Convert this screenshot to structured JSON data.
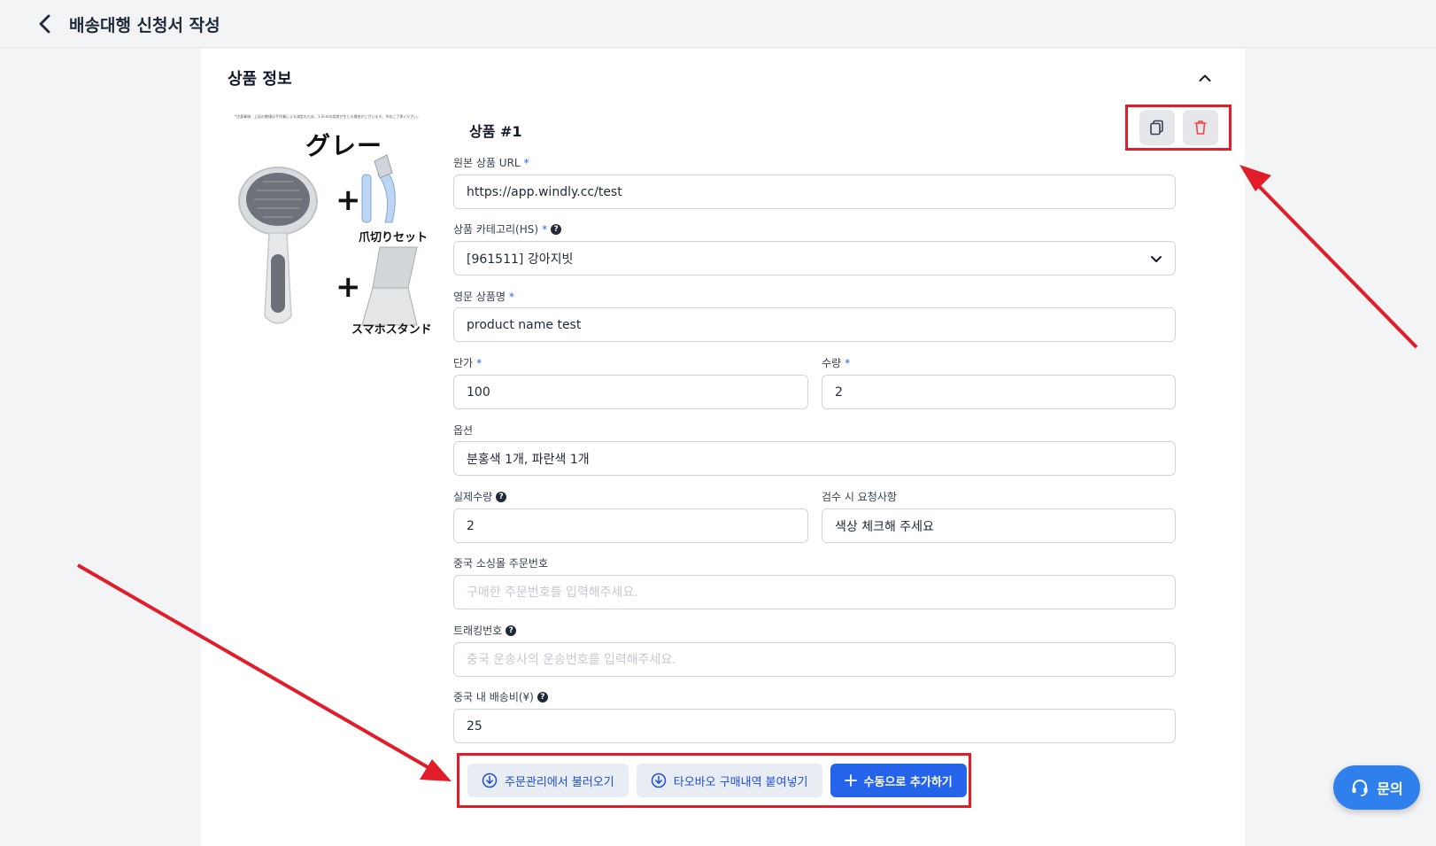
{
  "header": {
    "title": "배송대행 신청서 작성"
  },
  "section": {
    "title": "상품 정보"
  },
  "product_image": {
    "caption_top": "*注意事項：上記の数値は手作業による測定のため、1-2cmの誤差が生じる場合がございます。予めご了承ください。",
    "color_title": "グレー",
    "label_1": "爪切りセット",
    "label_2": "スマホスタンド"
  },
  "product": {
    "heading": "상품 #1",
    "url": {
      "label": "원본 상품 URL",
      "required": "*",
      "value": "https://app.windly.cc/test"
    },
    "category": {
      "label": "상품 카테고리(HS)",
      "required": "*",
      "value": "[961511] 강아지빗"
    },
    "english_name": {
      "label": "영문 상품명",
      "required": "*",
      "value": "product name test"
    },
    "unit_price": {
      "label": "단가",
      "required": "*",
      "value": "100"
    },
    "quantity": {
      "label": "수량",
      "required": "*",
      "value": "2"
    },
    "option": {
      "label": "옵션",
      "value": "분홍색 1개, 파란색 1개"
    },
    "actual_quantity": {
      "label": "실제수량",
      "value": "2"
    },
    "inspection_request": {
      "label": "검수 시 요청사항",
      "value": "색상 체크해 주세요"
    },
    "order_number": {
      "label": "중국 소싱몰 주문번호",
      "placeholder": "구매한 주문번호를 입력해주세요."
    },
    "tracking_number": {
      "label": "트래킹번호",
      "placeholder": "중국 운송사의 운송번호를 입력해주세요."
    },
    "china_shipping": {
      "label": "중국 내 배송비(¥)",
      "value": "25"
    }
  },
  "buttons": {
    "import_orders": "주문관리에서 불러오기",
    "paste_taobao": "타오바오 구매내역 붙여넣기",
    "add_manual": "수동으로 추가하기"
  },
  "chat": {
    "label": "문의"
  },
  "icons": {
    "back": "chevron-left-icon",
    "collapse": "chevron-up-icon",
    "copy": "copy-icon",
    "delete": "trash-icon",
    "select": "chevron-down-icon",
    "download": "download-circle-icon",
    "plus": "plus-icon",
    "chat": "headset-icon"
  },
  "colors": {
    "accent": "#2563eb",
    "annotation": "#e11d2a",
    "delete": "#ef4444",
    "chat": "#2f80ed"
  }
}
